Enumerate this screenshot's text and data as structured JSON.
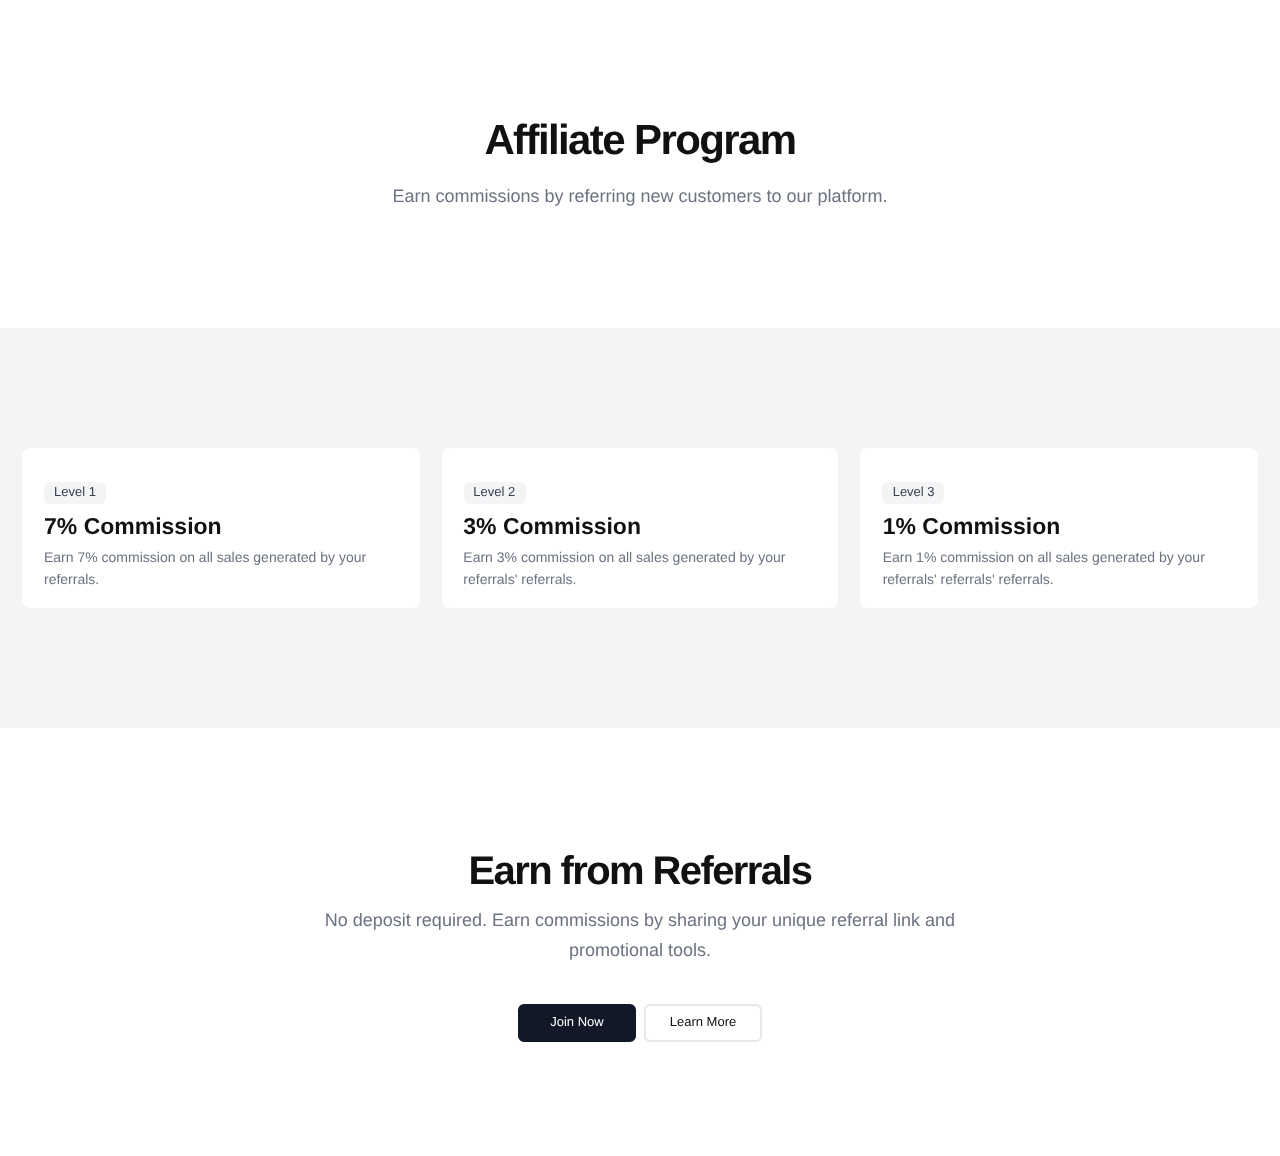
{
  "hero": {
    "title": "Affiliate Program",
    "subtitle": "Earn commissions by referring new customers to our platform."
  },
  "levels": [
    {
      "badge": "Level 1",
      "title": "7% Commission",
      "description": "Earn 7% commission on all sales generated by your referrals."
    },
    {
      "badge": "Level 2",
      "title": "3% Commission",
      "description": "Earn 3% commission on all sales generated by your referrals' referrals."
    },
    {
      "badge": "Level 3",
      "title": "1% Commission",
      "description": "Earn 1% commission on all sales generated by your referrals' referrals' referrals."
    }
  ],
  "cta": {
    "title": "Earn from Referrals",
    "subtitle": "No deposit required. Earn commissions by sharing your unique referral link and promotional tools.",
    "buttons": [
      {
        "label": "Join Now",
        "kind": "primary"
      },
      {
        "label": "Learn More",
        "kind": "secondary"
      }
    ]
  }
}
